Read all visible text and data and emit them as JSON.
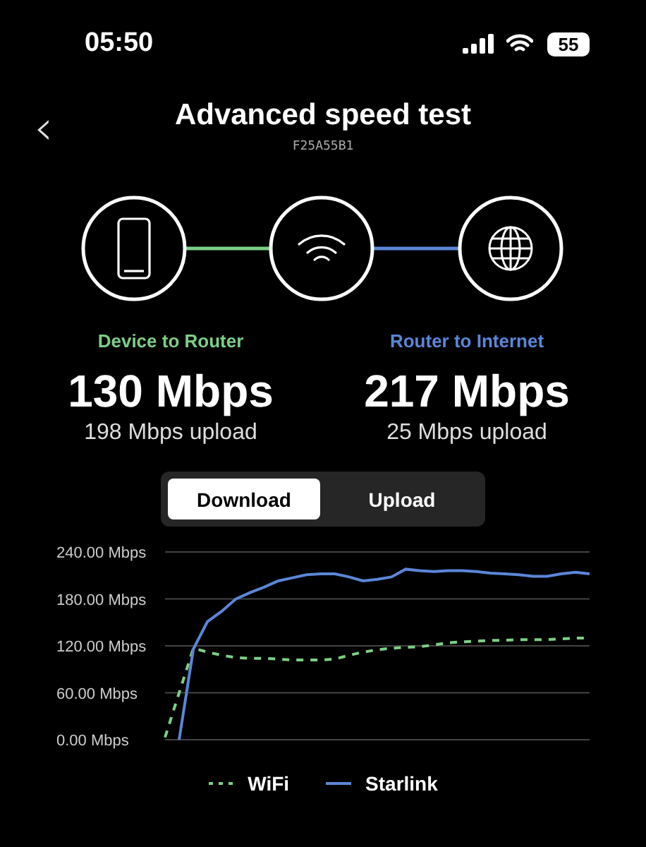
{
  "status_bar": {
    "time": "05:50",
    "battery": "55"
  },
  "header": {
    "back": "‹",
    "title": "Advanced speed test",
    "serial": "F25A55B1"
  },
  "nodes": [
    {
      "kind": "phone"
    },
    {
      "kind": "wifi"
    },
    {
      "kind": "globe"
    }
  ],
  "links": [
    {
      "label": "Device to Router",
      "color": "#7ccf86",
      "download": "130 Mbps",
      "upload": "198 Mbps upload"
    },
    {
      "label": "Router to Internet",
      "color": "#5b86d8",
      "download": "217 Mbps",
      "upload": "25 Mbps upload"
    }
  ],
  "tabs": [
    {
      "label": "Download",
      "selected": true
    },
    {
      "label": "Upload",
      "selected": false
    }
  ],
  "chart_data": {
    "type": "line",
    "ylim": [
      0,
      240
    ],
    "yticks": [
      {
        "value": 0,
        "label": "0.00 Mbps"
      },
      {
        "value": 60,
        "label": "60.00 Mbps"
      },
      {
        "value": 120,
        "label": "120.00 Mbps"
      },
      {
        "value": 180,
        "label": "180.00 Mbps"
      },
      {
        "value": 240,
        "label": "240.00 Mbps"
      }
    ],
    "grid": true,
    "legend": true,
    "series": [
      {
        "name": "WiFi",
        "color": "#7ccf86",
        "line_style": "dashed",
        "values": [
          3,
          60,
          117,
          112,
          108,
          105,
          104,
          104,
          103,
          102,
          102,
          102,
          103,
          108,
          112,
          115,
          117,
          118,
          119,
          121,
          124,
          125,
          126,
          127,
          127,
          128,
          128,
          128,
          129,
          130,
          130
        ]
      },
      {
        "name": "Starlink",
        "color": "#5b86d8",
        "line_style": "solid",
        "values": [
          null,
          0,
          116,
          151,
          164,
          180,
          188,
          195,
          203,
          207,
          211,
          212,
          212,
          208,
          203,
          205,
          208,
          218,
          216,
          215,
          216,
          216,
          215,
          213,
          212,
          211,
          209,
          209,
          212,
          214,
          212
        ]
      }
    ]
  }
}
